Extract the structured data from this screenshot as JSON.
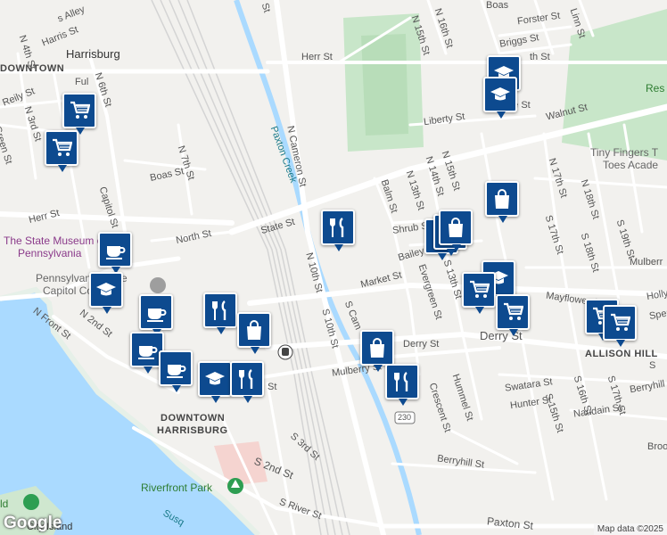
{
  "map": {
    "attribution": "Map data ©2025",
    "logo": "Google",
    "colors": {
      "water": "#aadaff",
      "park": "#c8e6c9",
      "road": "#ffffff",
      "marker": "#0d4a8f",
      "background": "#f2f1ee"
    }
  },
  "places": {
    "harrisburg": "Harrisburg",
    "downtown_top": "DOWNTOWN",
    "downtown_harrisburg_1": "DOWNTOWN",
    "downtown_harrisburg_2": "HARRISBURG",
    "allison_hill": "ALLISON HILL",
    "tiny_fingers_1": "Tiny Fingers T",
    "tiny_fingers_2": "Toes Acade",
    "state_museum_1": "The State Museum of",
    "state_museum_2": "Pennsylvania",
    "capitol_1": "Pennsylvania State",
    "capitol_2": "Capitol Complex",
    "riverfront_park": "Riverfront Park",
    "paxton_creek": "Paxton Creek",
    "susq": "Susq",
    "city_island": "City Island",
    "res": "Res",
    "route_230": "230",
    "ld": "ld"
  },
  "streets": {
    "n_cameron": "N Cameron St",
    "s_cameron": "S Cam",
    "herr_right": "Herr St",
    "herr_left": "Herr St",
    "state_st": "State St",
    "north_st": "North St",
    "boas_st": "Boas St",
    "capitol_st": "Capitol St",
    "n7th": "N 7th St",
    "n6th": "N 6th St",
    "n4th": "N 4th St",
    "n3rd": "N 3rd St",
    "n2nd": "N 2nd St",
    "n_front": "N Front St",
    "reily": "Reily St",
    "harris": "Harris St",
    "green": "Green St",
    "n10th": "N 10th St",
    "s10th": "S 10th St",
    "market": "Market St",
    "mulberry": "Mulberry St",
    "derry_mid": "Derry St",
    "derry_right": "Derry St",
    "liberty": "Liberty St",
    "walnut": "Walnut St",
    "briggs": "Briggs St",
    "forster": "Forster St",
    "linn": "Linn St",
    "boas_top": "Boas",
    "n16th": "N 16th St",
    "n15th_top": "N 15th St",
    "n15th": "N 15th St",
    "n14th": "N 14th St",
    "n13th": "N 13th St",
    "balm": "Balm St",
    "shrub": "Shrub St",
    "bailey": "Bailey S",
    "evergreen": "Evergreen St",
    "s13th": "S 13th St",
    "crescent": "Crescent St",
    "hummel": "Hummel St",
    "mayflower": "Mayflower St",
    "n17th": "N 17th St",
    "s17th_a": "S 17th St",
    "s17th_b": "S 17th St",
    "n18th": "N 18th St",
    "s18th": "S 18th St",
    "s19th": "S 19th St",
    "s16th": "S 16th St",
    "s15th": "S 15th St",
    "swatara": "Swatara St",
    "hunter": "Hunter St",
    "naudain": "Naudain St",
    "berryhill_right": "Berryhill",
    "berryhill": "Berryhill St",
    "paxton": "Paxton St",
    "s_river": "S River St",
    "s2nd": "S 2nd St",
    "s3rd": "S 3rd St",
    "s_st": "St",
    "n_top_st": "St",
    "holly": "Holly",
    "sper": "Sper",
    "brook": "Broo",
    "mulberr_right": "Mulberr",
    "n2nd_s": "S",
    "ter": "th St",
    "ful": "Ful",
    "ate": "ate St",
    "tt": "nt",
    "s_ca": "S Ca",
    "alley": "s Alley",
    "n16_top": "N 16th St"
  },
  "markers": [
    {
      "icon": "shopping-cart-icon",
      "kind": "grocery"
    },
    {
      "icon": "shopping-cart-icon",
      "kind": "grocery"
    },
    {
      "icon": "graduation-cap-icon",
      "kind": "school"
    },
    {
      "icon": "graduation-cap-icon",
      "kind": "school"
    },
    {
      "icon": "shopping-bag-icon",
      "kind": "shop"
    },
    {
      "icon": "fork-knife-icon",
      "kind": "restaurant"
    },
    {
      "icon": "shopping-bag-icon",
      "kind": "shop"
    },
    {
      "icon": "shopping-bag-icon",
      "kind": "shop"
    },
    {
      "icon": "shopping-bag-icon",
      "kind": "shop"
    },
    {
      "icon": "graduation-cap-icon",
      "kind": "school"
    },
    {
      "icon": "shopping-cart-icon",
      "kind": "grocery"
    },
    {
      "icon": "shopping-cart-icon",
      "kind": "grocery"
    },
    {
      "icon": "shopping-cart-icon",
      "kind": "grocery"
    },
    {
      "icon": "shopping-cart-icon",
      "kind": "grocery"
    },
    {
      "icon": "coffee-cup-icon",
      "kind": "cafe"
    },
    {
      "icon": "graduation-cap-icon",
      "kind": "school"
    },
    {
      "icon": "coffee-cup-icon",
      "kind": "cafe"
    },
    {
      "icon": "fork-knife-icon",
      "kind": "restaurant"
    },
    {
      "icon": "shopping-bag-icon",
      "kind": "shop"
    },
    {
      "icon": "coffee-cup-icon",
      "kind": "cafe"
    },
    {
      "icon": "coffee-cup-icon",
      "kind": "cafe"
    },
    {
      "icon": "graduation-cap-icon",
      "kind": "school"
    },
    {
      "icon": "fork-knife-icon",
      "kind": "restaurant"
    },
    {
      "icon": "shopping-bag-icon",
      "kind": "shop"
    },
    {
      "icon": "fork-knife-icon",
      "kind": "restaurant"
    }
  ]
}
